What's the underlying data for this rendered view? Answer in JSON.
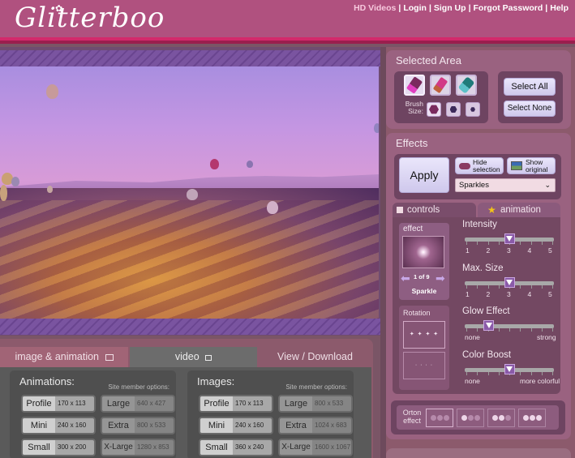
{
  "header": {
    "logo": "Glitterboo",
    "links": [
      "HD Videos",
      "Login",
      "Sign Up",
      "Forgot Password",
      "Help"
    ],
    "separator": "|"
  },
  "colors": {
    "header_bg": "#b0517f",
    "accent_pink": "#d3296b",
    "panel_bg": "#8c5a6c",
    "canvas_stripe": "#7a54a0"
  },
  "canvas": {
    "image_description": "Hot air balloons over Cappadocia valley with purple tint and sparkle effect"
  },
  "output_tabs": [
    {
      "label": "image & animation",
      "icon": "image-icon"
    },
    {
      "label": "video",
      "icon": "video-camera-icon"
    },
    {
      "label": "View / Download"
    }
  ],
  "animations": {
    "title": "Animations:",
    "member_label": "Site member options:",
    "free": [
      {
        "name": "Profile",
        "size": "170 x 113"
      },
      {
        "name": "Mini",
        "size": "240 x 160"
      },
      {
        "name": "Small",
        "size": "300 x 200"
      }
    ],
    "member": [
      {
        "name": "Large",
        "size": "640 x 427"
      },
      {
        "name": "Extra",
        "size": "800 x 533"
      },
      {
        "name": "X-Large",
        "size": "1280 x 853"
      }
    ]
  },
  "images": {
    "title": "Images:",
    "member_label": "Site member options:",
    "free": [
      {
        "name": "Profile",
        "size": "170 x 113"
      },
      {
        "name": "Mini",
        "size": "240 x 160"
      },
      {
        "name": "Small",
        "size": "360 x 240"
      }
    ],
    "member": [
      {
        "name": "Large",
        "size": "800 x 533"
      },
      {
        "name": "Extra",
        "size": "1024 x 683"
      },
      {
        "name": "X-Large",
        "size": "1600 x 1067"
      }
    ]
  },
  "selected_area": {
    "title": "Selected Area",
    "tools": [
      "highlighter-brush-icon",
      "marker-brush-icon",
      "eraser-icon"
    ],
    "brush_size_label": "Brush Size:",
    "brush_sizes": [
      "large",
      "medium",
      "small"
    ],
    "select_all": "Select All",
    "select_none": "Select None"
  },
  "effects": {
    "title": "Effects",
    "apply": "Apply",
    "hide_selection": "Hide selection",
    "show_original": "Show original",
    "effect_select": "Sparkles",
    "tabs": {
      "controls": "controls",
      "animation": "animation"
    },
    "effect_label": "effect",
    "effect_index": "1 of 9",
    "effect_name": "Sparkle",
    "rotation_label": "Rotation",
    "rotation_options": [
      "✦ ✦ ✦ ✦",
      "· · · ·"
    ],
    "intensity": {
      "label": "Intensity",
      "value": 3,
      "min": 1,
      "max": 5,
      "scale": [
        "1",
        "2",
        "3",
        "4",
        "5"
      ]
    },
    "max_size": {
      "label": "Max. Size",
      "value": 3,
      "min": 1,
      "max": 5,
      "scale": [
        "1",
        "2",
        "3",
        "4",
        "5"
      ]
    },
    "glow": {
      "label": "Glow Effect",
      "value_fraction": 0.25,
      "min_label": "none",
      "max_label": "strong"
    },
    "color_boost": {
      "label": "Color Boost",
      "value_fraction": 0.5,
      "min_label": "none",
      "max_label": "more colorful"
    },
    "orton_label": "Orton effect",
    "orton_levels": [
      0,
      1,
      2,
      3
    ],
    "orton_selected": 0
  }
}
